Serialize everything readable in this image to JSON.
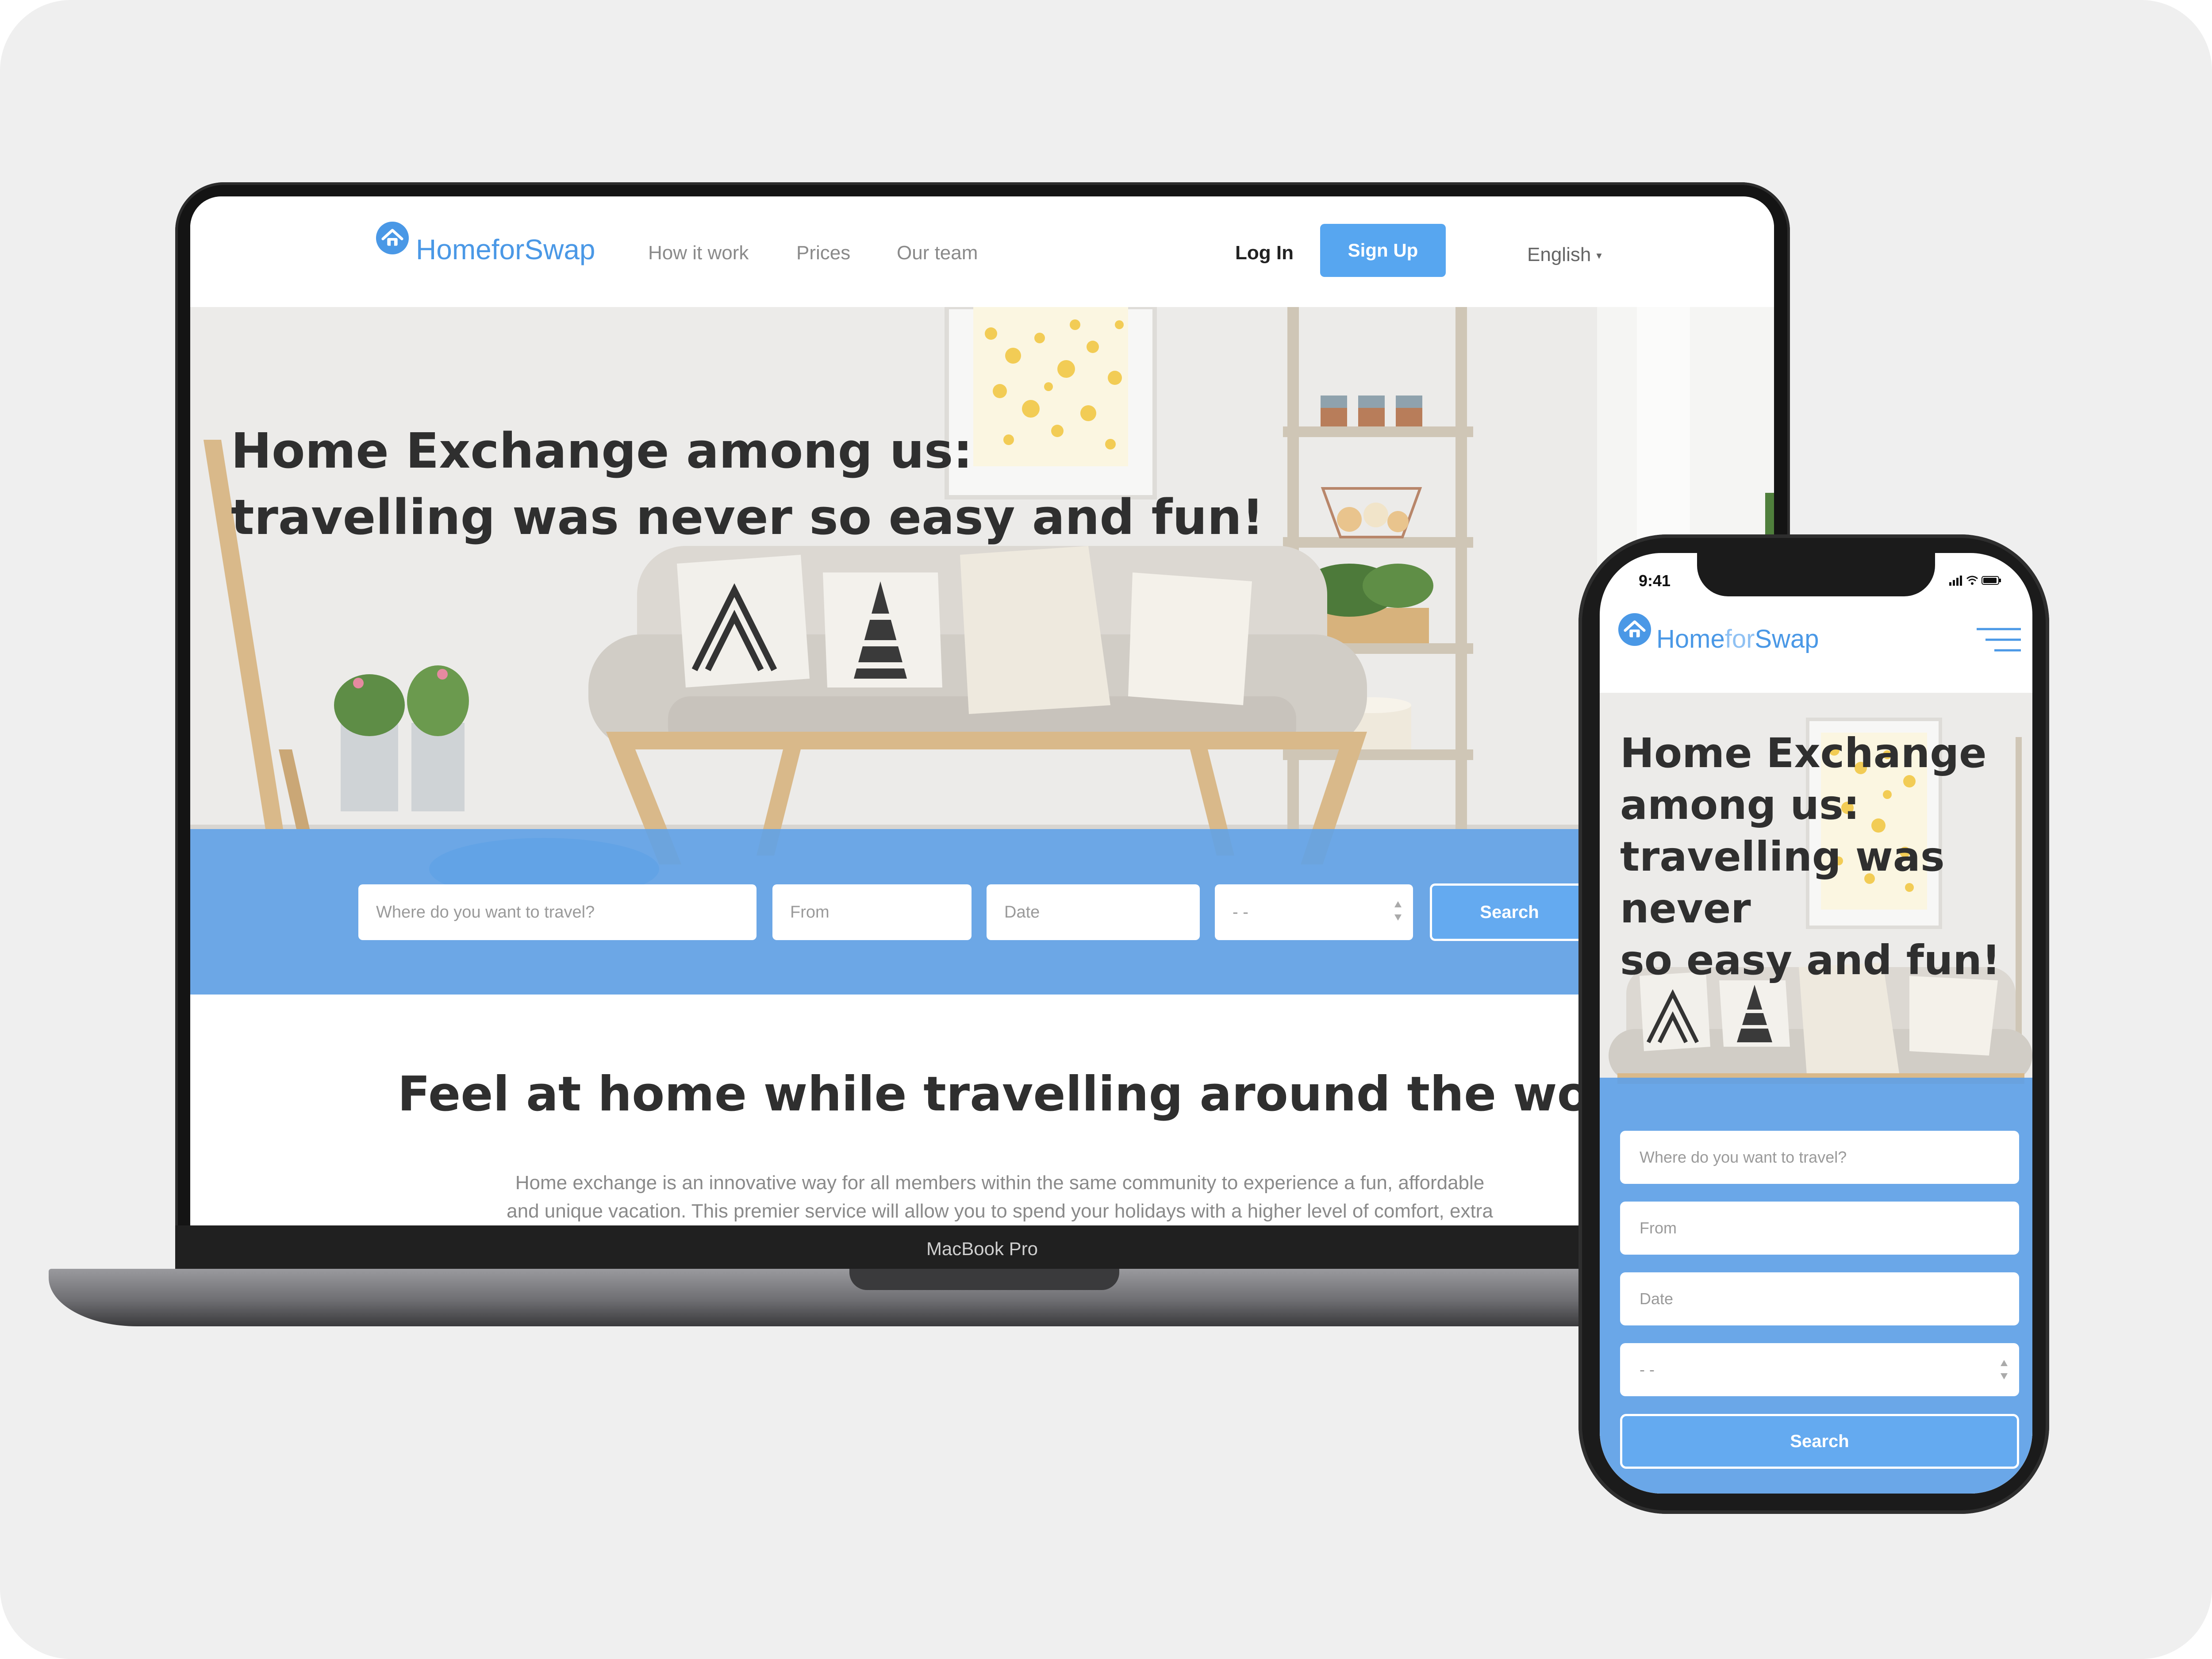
{
  "brand": {
    "name_a": "Home",
    "name_b": "for",
    "name_c": "Swap",
    "color": "#4a98e6"
  },
  "laptop": {
    "device_label": "MacBook Pro",
    "nav": {
      "links": [
        "How it work",
        "Prices",
        "Our team"
      ],
      "login": "Log In",
      "signup": "Sign Up",
      "language": "English"
    },
    "hero": {
      "headline_line1": "Home Exchange among us:",
      "headline_line2": "travelling was never so easy and fun!"
    },
    "search": {
      "destination_placeholder": "Where do you want to travel?",
      "from_placeholder": "From",
      "date_placeholder": "Date",
      "guests_value": "- -",
      "button": "Search"
    },
    "section": {
      "title": "Feel at home while travelling around the world",
      "para_line1": "Home exchange is an innovative way for all members within the same community to experience a fun, affordable",
      "para_line2": "and unique vacation. This premier service will allow you to spend your holidays with a higher level of comfort, extra"
    }
  },
  "phone": {
    "time": "9:41",
    "hero": {
      "headline_lines": [
        "Home Exchange",
        "among us:",
        "travelling was never",
        "so easy and fun!"
      ]
    },
    "search": {
      "destination_placeholder": "Where do you want to travel?",
      "from_placeholder": "From",
      "date_placeholder": "Date",
      "guests_value": "- -",
      "button": "Search"
    },
    "icons": [
      "home-icon",
      "hamburger-menu-icon",
      "signal-icon",
      "wifi-icon",
      "battery-icon"
    ]
  },
  "colors": {
    "accent": "#57a6f0",
    "band": "#5ca0e8",
    "text_dark": "#2f2f2f"
  }
}
